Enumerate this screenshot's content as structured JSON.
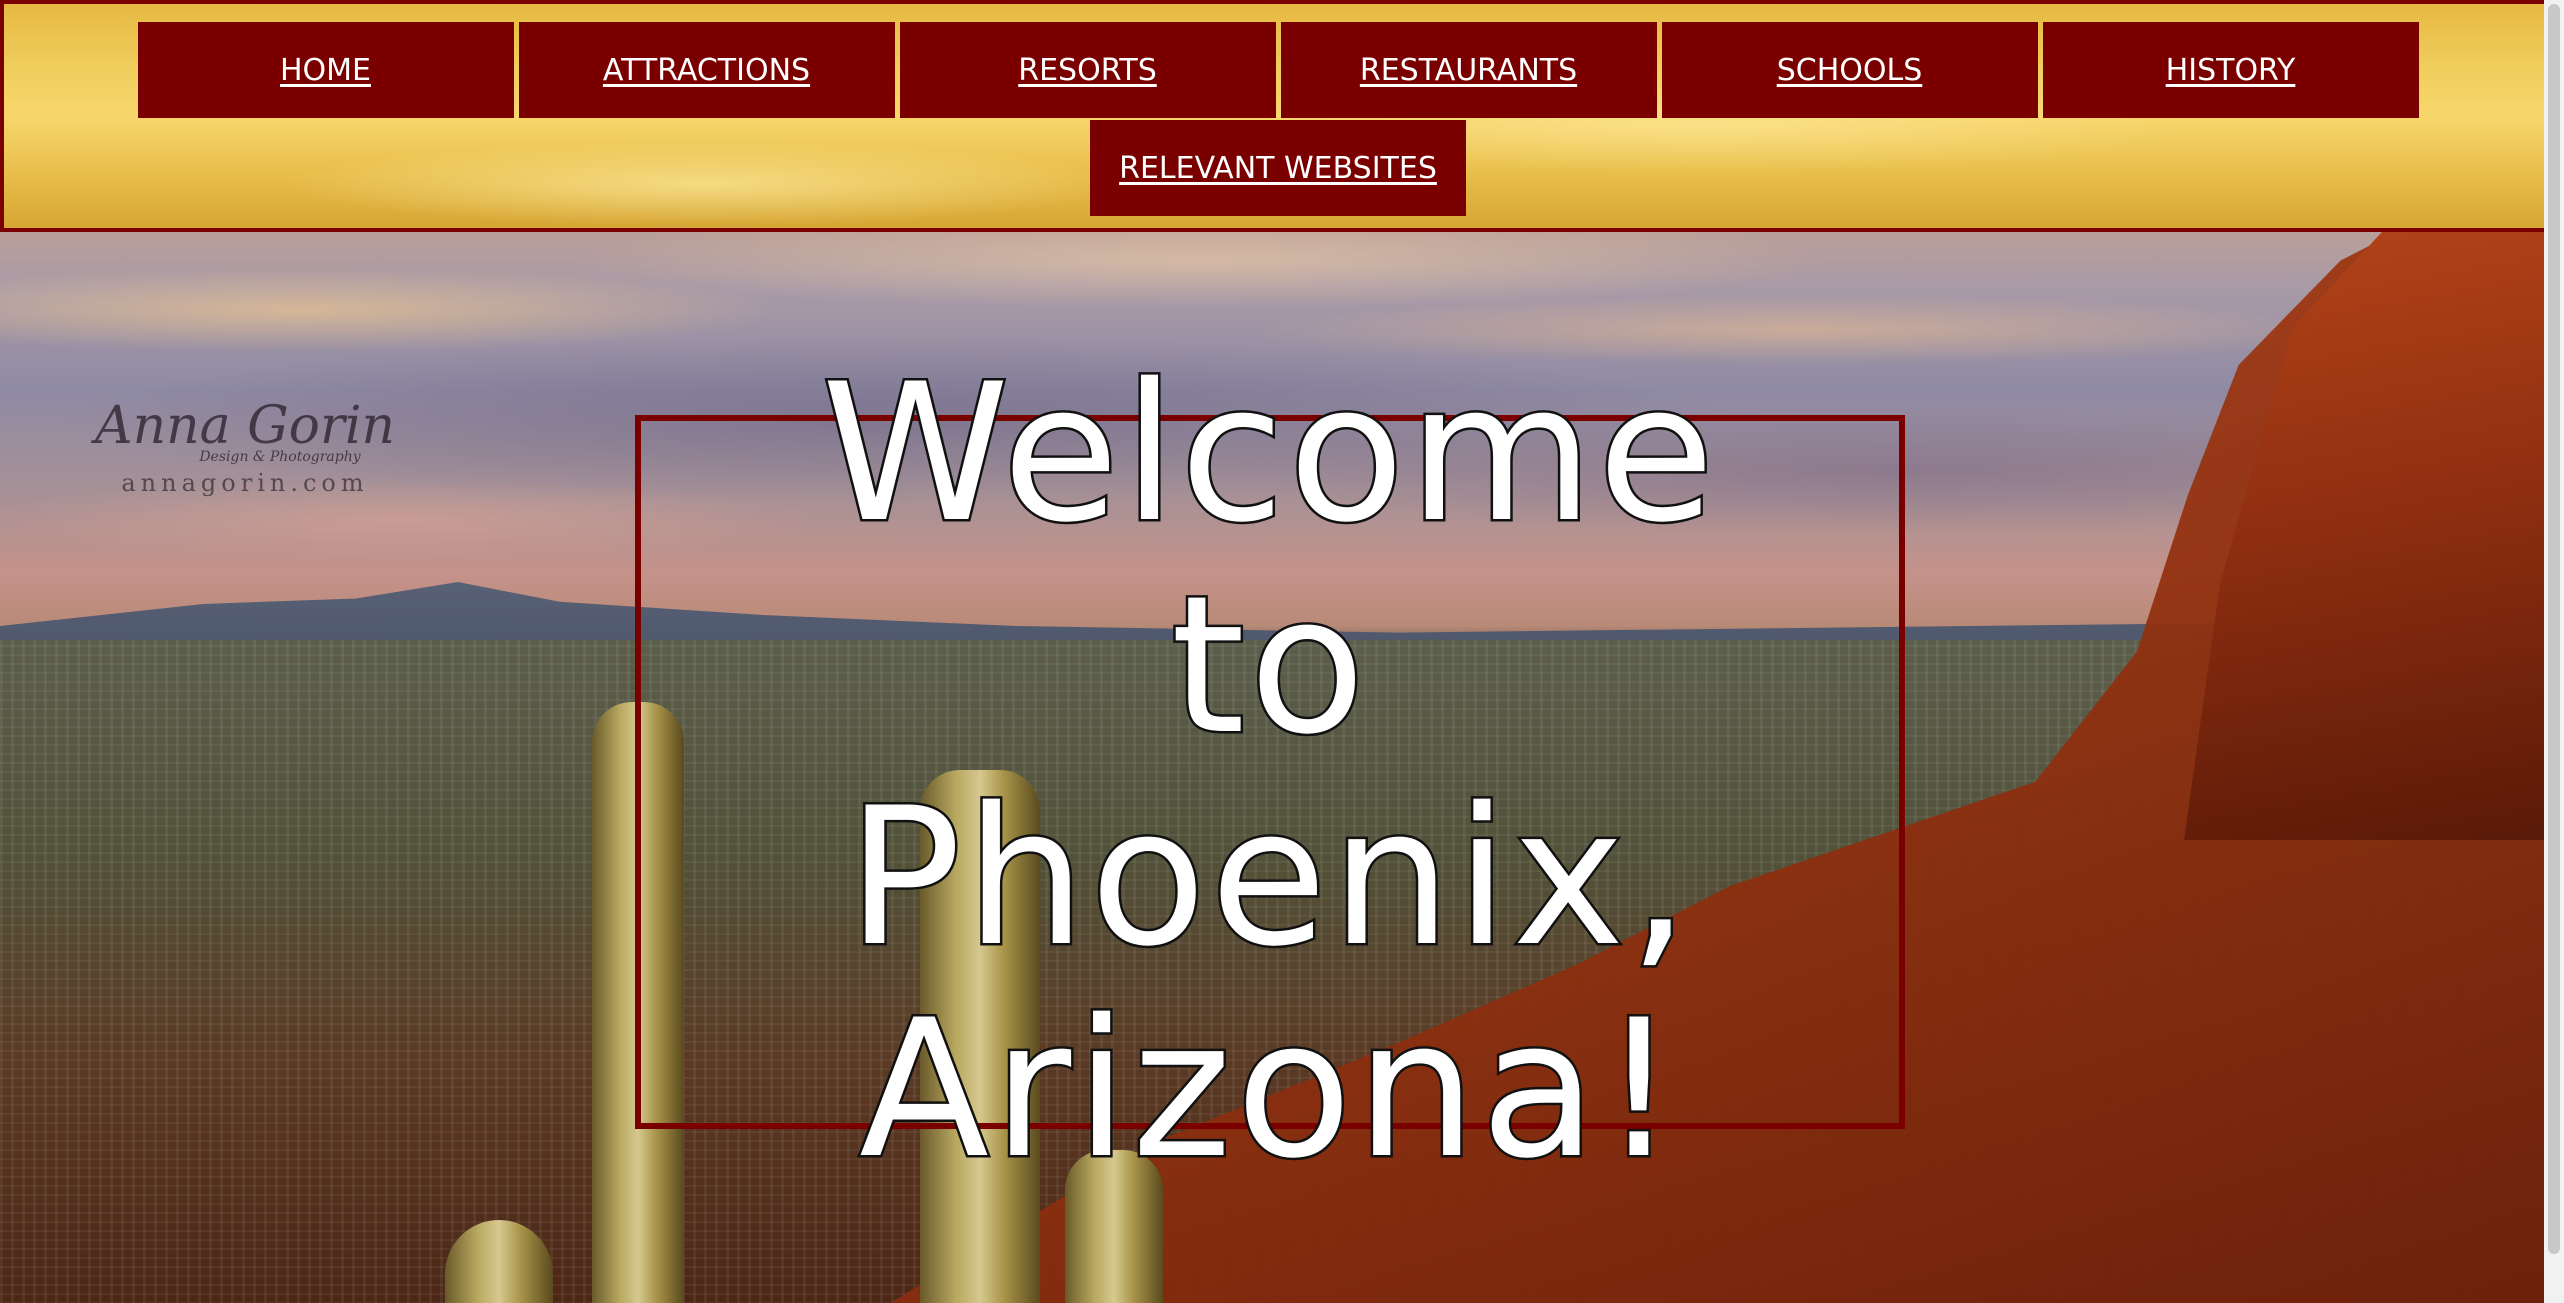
{
  "nav": {
    "items": [
      {
        "label": "HOME"
      },
      {
        "label": "ATTRACTIONS"
      },
      {
        "label": "RESORTS"
      },
      {
        "label": "RESTAURANTS"
      },
      {
        "label": "SCHOOLS"
      },
      {
        "label": "HISTORY"
      },
      {
        "label": "RELEVANT WEBSITES"
      }
    ]
  },
  "hero": {
    "title": "Welcome to Phoenix, Arizona!",
    "watermark": {
      "name": "Anna Gorin",
      "subtitle": "Design & Photography",
      "url": "annagorin.com"
    }
  },
  "colors": {
    "nav_background": "#7a0000",
    "nav_link": "#ffffff",
    "bar_gold": "#f1cf5e",
    "title_fill": "#ffffff",
    "title_outline": "#111111"
  }
}
